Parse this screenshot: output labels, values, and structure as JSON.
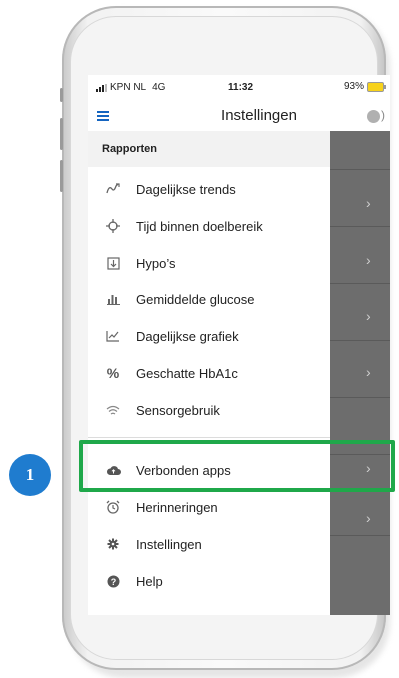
{
  "status_bar": {
    "carrier": "KPN NL",
    "network": "4G",
    "time": "11:32",
    "battery": "93%"
  },
  "header": {
    "title": "Instellingen"
  },
  "drawer": {
    "section_label": "Rapporten",
    "items": [
      {
        "label": "Dagelijkse trends",
        "icon": "trend-icon"
      },
      {
        "label": "Tijd binnen doelbereik",
        "icon": "crosshair-icon"
      },
      {
        "label": "Hypo’s",
        "icon": "hypo-icon"
      },
      {
        "label": "Gemiddelde glucose",
        "icon": "bar-chart-icon"
      },
      {
        "label": "Dagelijkse grafiek",
        "icon": "line-chart-icon"
      },
      {
        "label": "Geschatte HbA1c",
        "icon": "percent-icon"
      },
      {
        "label": "Sensorgebruik",
        "icon": "wifi-icon"
      },
      {
        "label": "Verbonden apps",
        "icon": "cloud-icon"
      },
      {
        "label": "Herinneringen",
        "icon": "alarm-clock-icon"
      },
      {
        "label": "Instellingen",
        "icon": "gear-icon"
      },
      {
        "label": "Help",
        "icon": "help-icon"
      }
    ]
  },
  "callout": {
    "number": "1"
  },
  "colors": {
    "accent": "#1565c0",
    "highlight": "#1fa84a",
    "badge": "#1f7ccf"
  }
}
